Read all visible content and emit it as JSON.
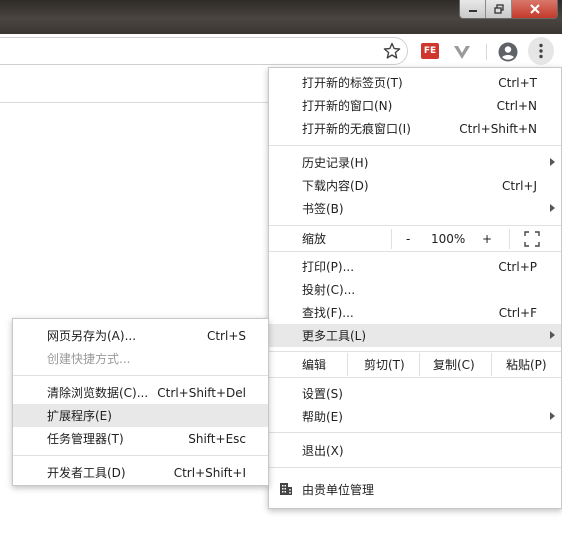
{
  "toolbar": {
    "ext_fe_label": "FE"
  },
  "main_menu": {
    "items_top": [
      {
        "label": "打开新的标签页(T)",
        "shortcut": "Ctrl+T"
      },
      {
        "label": "打开新的窗口(N)",
        "shortcut": "Ctrl+N"
      },
      {
        "label": "打开新的无痕窗口(I)",
        "shortcut": "Ctrl+Shift+N"
      }
    ],
    "history": {
      "label": "历史记录(H)"
    },
    "downloads": {
      "label": "下载内容(D)",
      "shortcut": "Ctrl+J"
    },
    "bookmarks": {
      "label": "书签(B)"
    },
    "zoom": {
      "label": "缩放",
      "minus": "-",
      "value": "100%",
      "plus": "+"
    },
    "print": {
      "label": "打印(P)...",
      "shortcut": "Ctrl+P"
    },
    "cast": {
      "label": "投射(C)..."
    },
    "find": {
      "label": "查找(F)...",
      "shortcut": "Ctrl+F"
    },
    "more_tools": {
      "label": "更多工具(L)"
    },
    "edit": {
      "label": "编辑",
      "cut": "剪切(T)",
      "copy": "复制(C)",
      "paste": "粘贴(P)"
    },
    "settings": {
      "label": "设置(S)"
    },
    "help": {
      "label": "帮助(E)"
    },
    "exit": {
      "label": "退出(X)"
    },
    "managed": {
      "label": "由贵单位管理"
    }
  },
  "sub_menu": {
    "save_page": {
      "label": "网页另存为(A)...",
      "shortcut": "Ctrl+S"
    },
    "create_shortcut": {
      "label": "创建快捷方式..."
    },
    "clear_data": {
      "label": "清除浏览数据(C)...",
      "shortcut": "Ctrl+Shift+Del"
    },
    "extensions": {
      "label": "扩展程序(E)"
    },
    "task_manager": {
      "label": "任务管理器(T)",
      "shortcut": "Shift+Esc"
    },
    "dev_tools": {
      "label": "开发者工具(D)",
      "shortcut": "Ctrl+Shift+I"
    }
  },
  "colors": {
    "highlight": "#e8e8e8",
    "close_button": "#c4392a",
    "ext_fe": "#d0372c"
  }
}
